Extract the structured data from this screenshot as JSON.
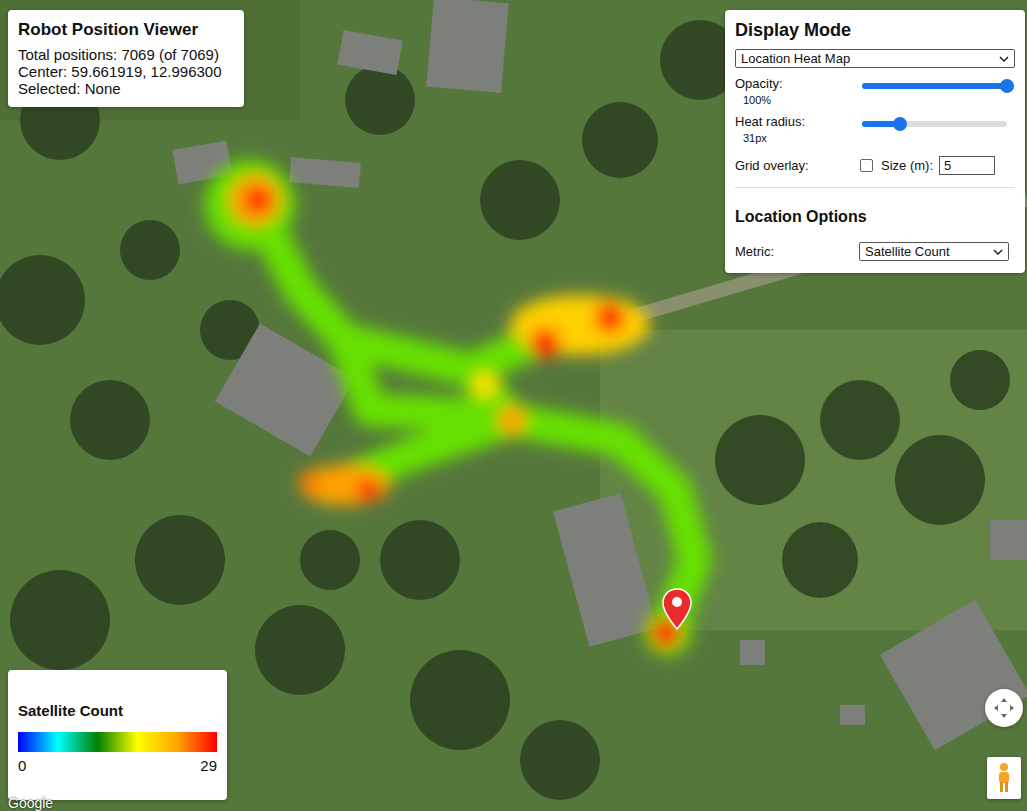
{
  "info_panel": {
    "title": "Robot Position Viewer",
    "lines": [
      "Total positions: 7069 (of 7069)",
      "Center: 59.661919, 12.996300",
      "Selected: None"
    ]
  },
  "display_panel": {
    "title": "Display Mode",
    "mode": "Location Heat Map",
    "sliders": [
      {
        "label": "Opacity:",
        "reading": "100%",
        "level": 1.0
      },
      {
        "label": "Heat radius:",
        "reading": "31px",
        "level": 0.26
      }
    ],
    "grid": {
      "label": "Grid overlay:",
      "checked": false,
      "size_label": "Size (m):",
      "size_value": "5"
    },
    "section_title": "Location Options",
    "metric_label": "Metric:",
    "metric": "Satellite Count"
  },
  "legend": {
    "title": "Satellite Count",
    "min": "0",
    "max": "29"
  },
  "attribution": "Google"
}
